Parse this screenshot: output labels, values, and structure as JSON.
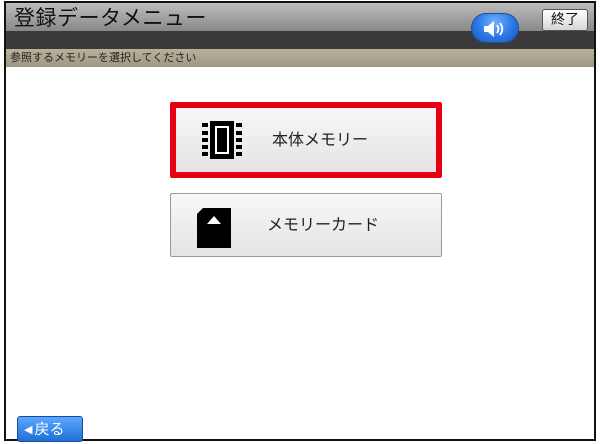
{
  "header": {
    "title": "登録データメニュー",
    "subtitle": "参照するメモリーを選択してください",
    "speaker_icon": "speaker-icon",
    "end_label": "終了"
  },
  "menu": {
    "items": [
      {
        "label": "本体メモリー",
        "icon": "chip-icon",
        "selected": true
      },
      {
        "label": "メモリーカード",
        "icon": "sd-card-icon",
        "selected": false
      }
    ]
  },
  "footer": {
    "back_label": "戻る",
    "back_icon": "triangle-left-icon"
  },
  "colors": {
    "selection": "#e60012",
    "accent": "#2b78e4"
  }
}
